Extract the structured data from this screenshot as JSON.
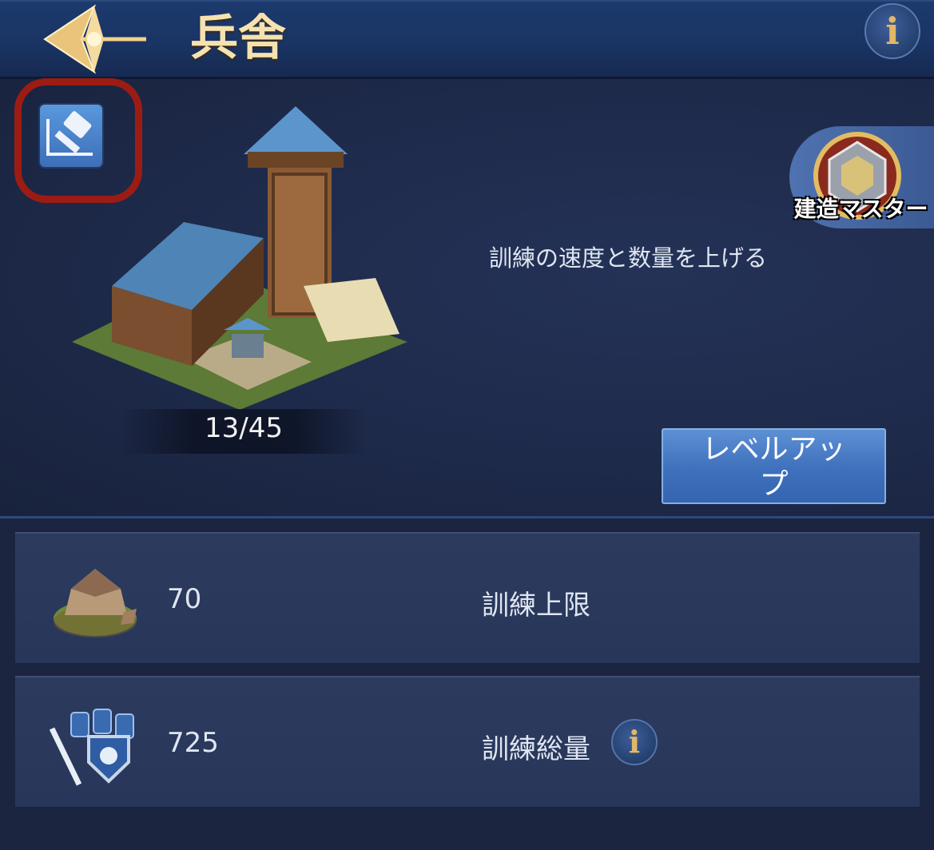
{
  "header": {
    "title": "兵舎",
    "info_icon": "i"
  },
  "building": {
    "level": "13/45",
    "description": "訓練の速度と数量を上げる"
  },
  "master_badge": {
    "label": "建造マスター"
  },
  "actions": {
    "levelup_line1": "レベルアッ",
    "levelup_line2": "プ"
  },
  "stats": [
    {
      "value": "70",
      "label": "訓練上限",
      "icon": "tent-icon"
    },
    {
      "value": "725",
      "label": "訓練総量",
      "icon": "troops-shield-icon",
      "info_icon": "i"
    }
  ],
  "colors": {
    "accent": "#4a7ec8",
    "title": "#f6e2b0",
    "highlight": "#9c1c14",
    "info_glyph": "#e2b766"
  }
}
